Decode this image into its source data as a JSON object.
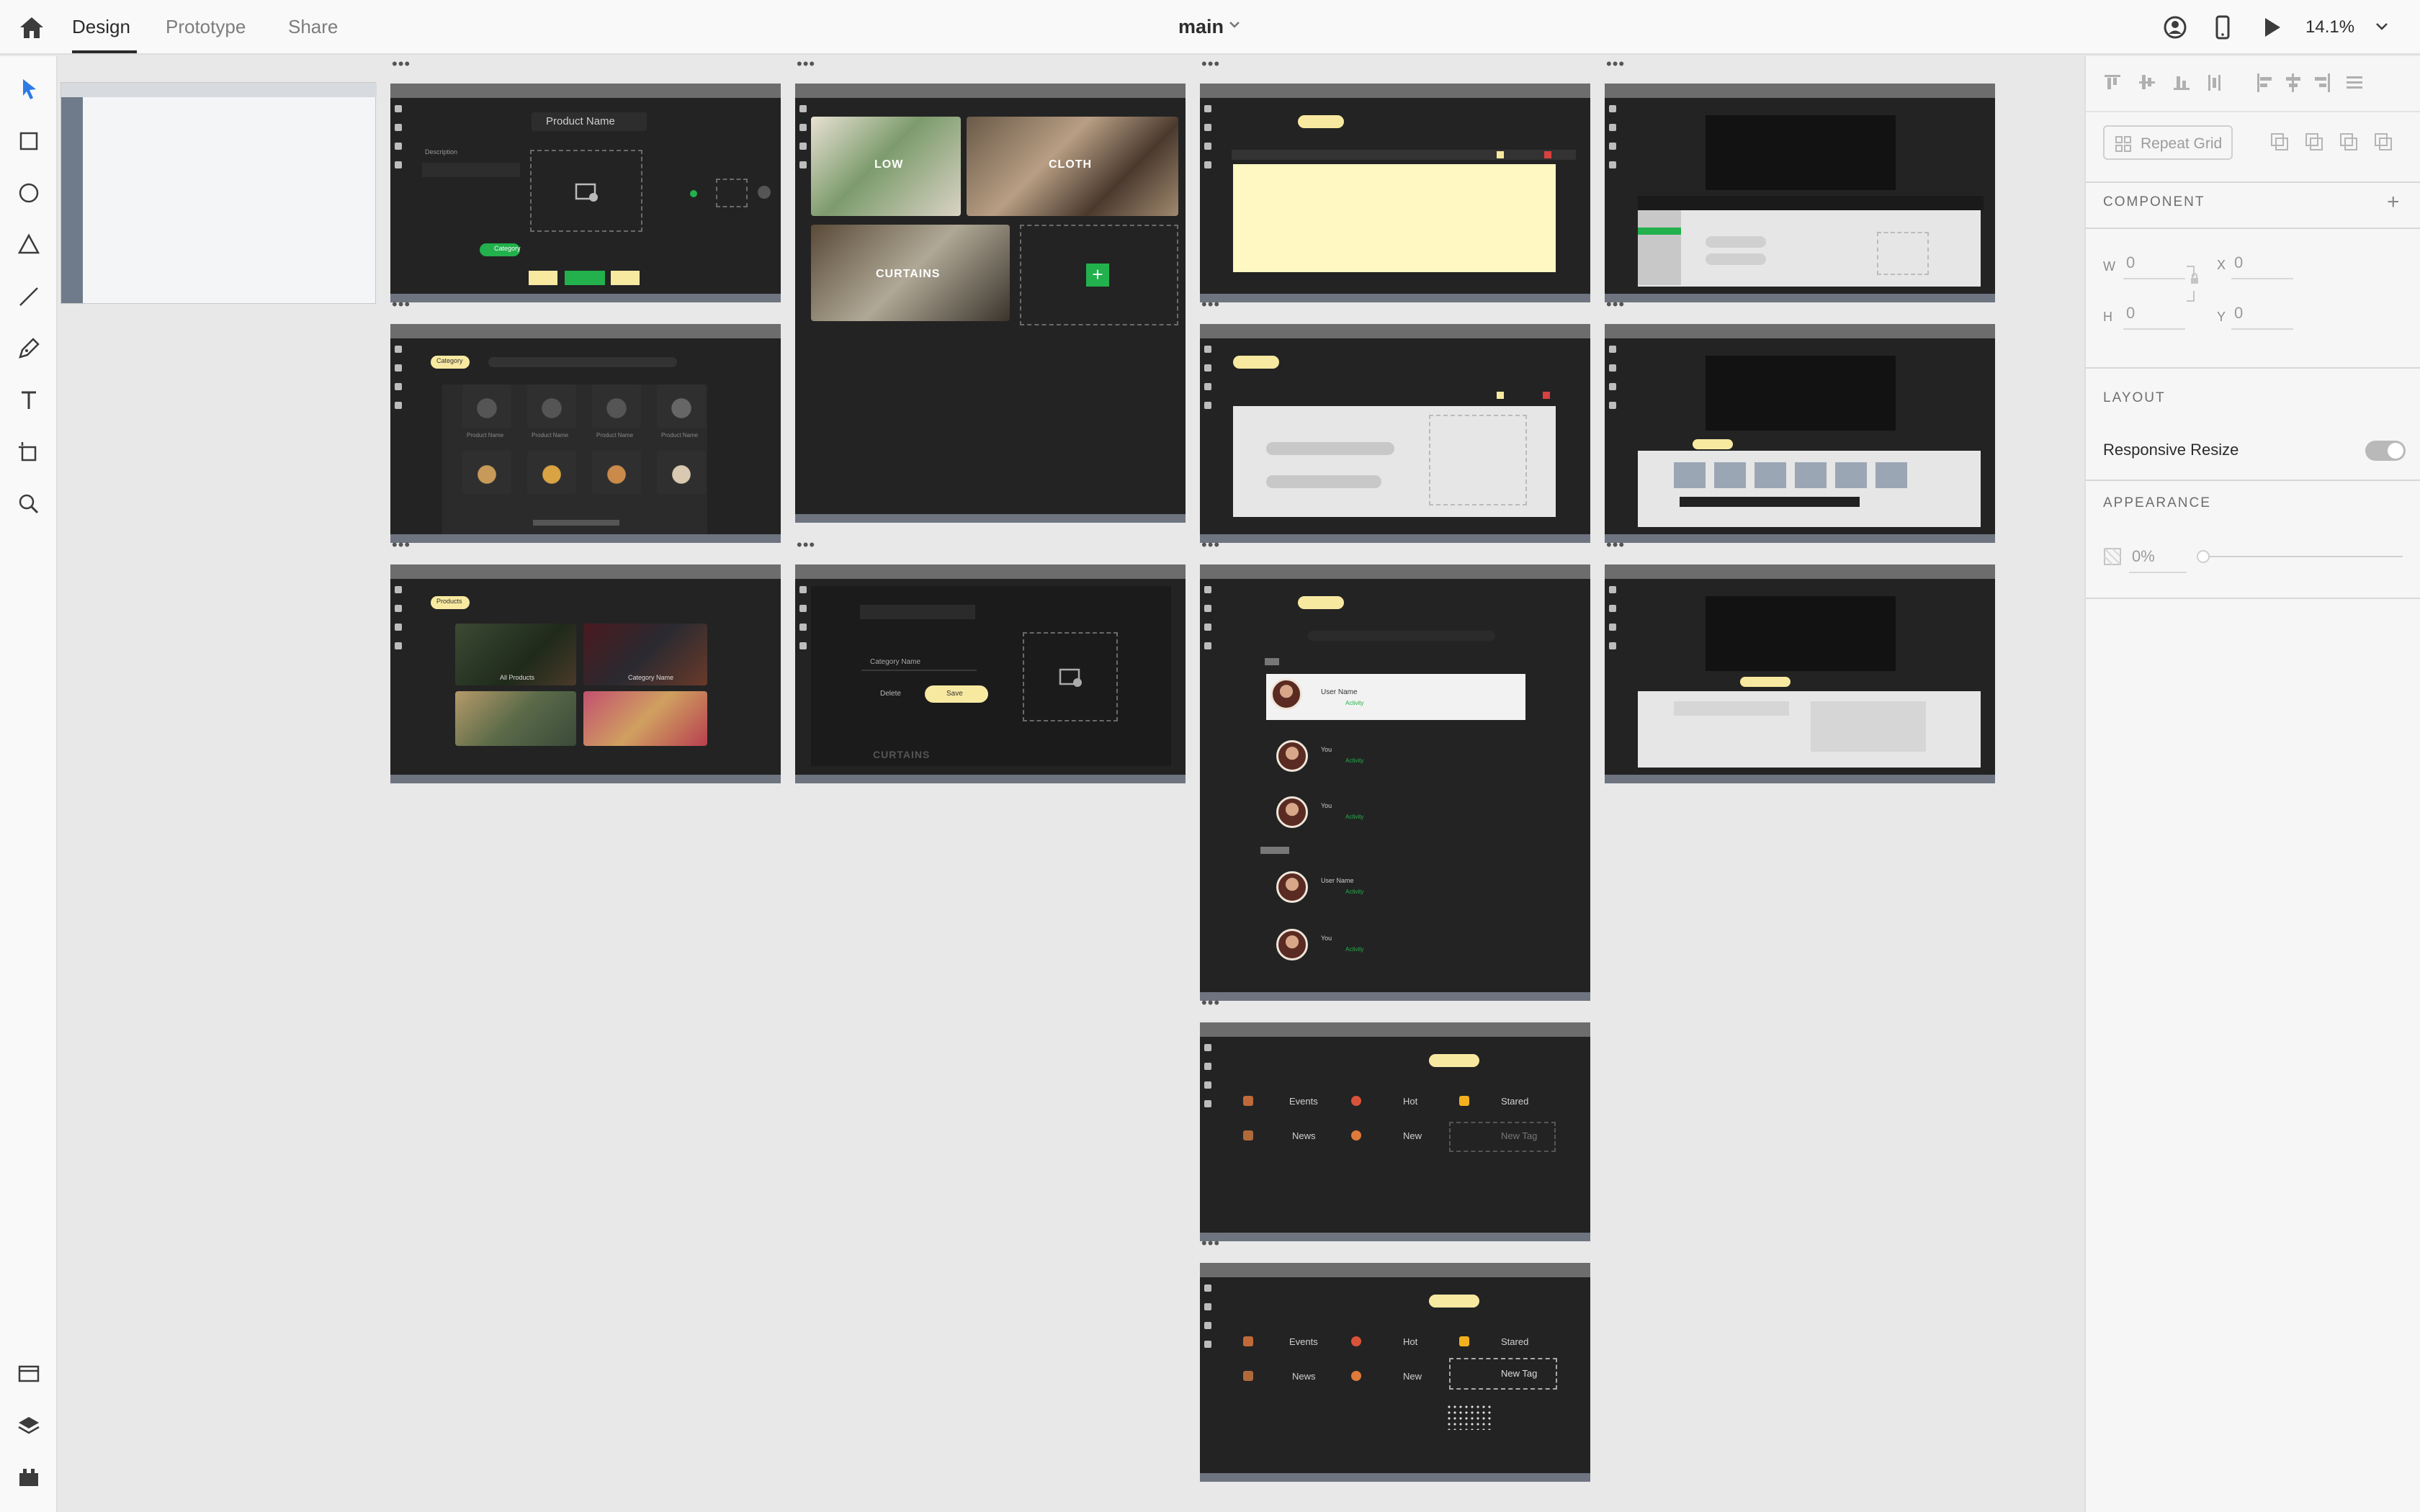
{
  "topbar": {
    "tabs": [
      "Design",
      "Prototype",
      "Share"
    ],
    "document_title": "main",
    "zoom": "14.1%"
  },
  "left_tools": [
    "select-icon",
    "rectangle-icon",
    "ellipse-icon",
    "triangle-icon",
    "line-icon",
    "pen-icon",
    "text-icon",
    "artboard-icon",
    "zoom-icon"
  ],
  "left_bottom_tools": [
    "assets-icon",
    "layers-icon",
    "plugins-icon"
  ],
  "right_panel": {
    "repeat_grid": "Repeat Grid",
    "component_label": "COMPONENT",
    "w_label": "W",
    "w_value": "0",
    "x_label": "X",
    "x_value": "0",
    "h_label": "H",
    "h_value": "0",
    "y_label": "Y",
    "y_value": "0",
    "layout_label": "LAYOUT",
    "responsive_resize": "Responsive Resize",
    "appearance_label": "APPEARANCE",
    "opacity": "0%"
  },
  "artboards": {
    "product_form": {
      "title": "Product Name",
      "description": "Description",
      "category": "Category"
    },
    "categories_grid": {
      "category_pill": "Category",
      "product_names": [
        "Product Name",
        "Product Name",
        "Product Name",
        "Product Name"
      ]
    },
    "category_tiles": {
      "tiles": [
        "LOW",
        "CLOTH",
        "CURTAINS"
      ]
    },
    "products_grid": {
      "pill": "Products",
      "labels": [
        "All Products",
        "Category Name"
      ]
    },
    "category_edit": {
      "field": "Category Name",
      "delete": "Delete",
      "save": "Save",
      "ghost": "CURTAINS"
    },
    "activity_feed": {
      "entries": [
        {
          "name": "User Name",
          "detail": "Activity"
        },
        {
          "name": "You",
          "detail": "Activity"
        },
        {
          "name": "You",
          "detail": "Activity"
        },
        {
          "name": "User Name",
          "detail": "Activity"
        },
        {
          "name": "You",
          "detail": "Activity"
        }
      ]
    },
    "tags": {
      "items": [
        "Events",
        "Hot",
        "Stared",
        "News",
        "New",
        "New Tag"
      ]
    },
    "tags_2": {
      "items": [
        "Events",
        "Hot",
        "Stared",
        "News",
        "New",
        "New Tag"
      ]
    }
  },
  "colors": {
    "accent_yellow": "#f8e9a1",
    "accent_green": "#22b14c",
    "artboard_bg": "#232323",
    "canvas_bg": "#e8e8e8"
  }
}
